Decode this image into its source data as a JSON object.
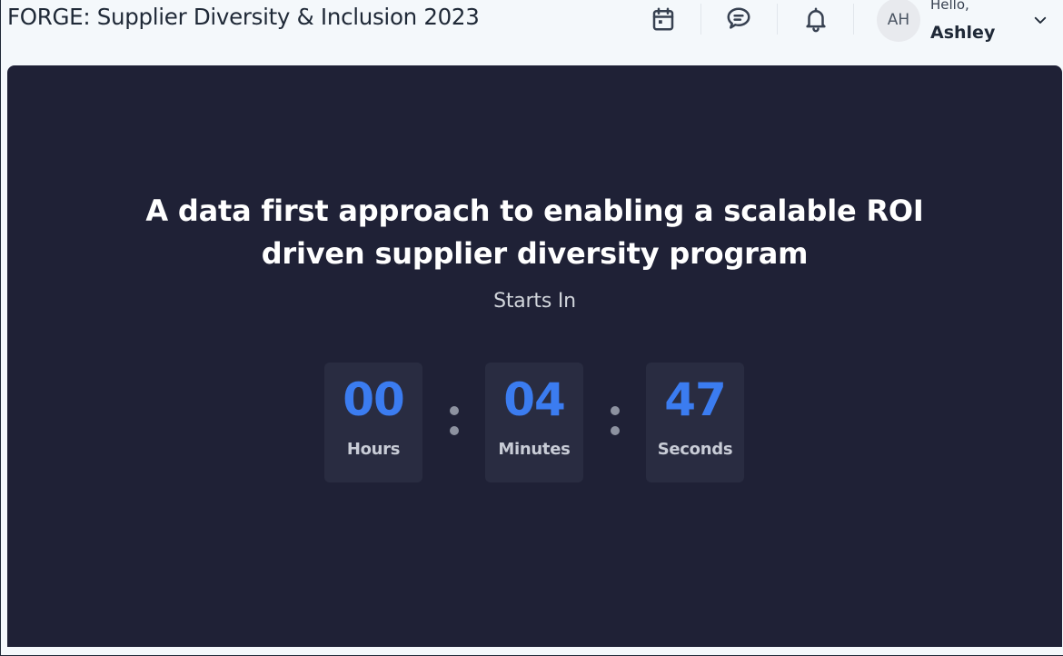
{
  "header": {
    "event_title": "FORGE: Supplier Diversity & Inclusion 2023",
    "icons": [
      "calendar-icon",
      "chat-icon",
      "bell-icon",
      "chevron-down-icon"
    ],
    "user": {
      "initials": "AH",
      "greeting": "Hello,",
      "name": "Ashley"
    }
  },
  "session": {
    "headline": "A data first approach to enabling a scalable ROI driven supplier diversity program",
    "starts_in_label": "Starts In",
    "countdown": {
      "hours": "00",
      "hours_label": "Hours",
      "minutes": "04",
      "minutes_label": "Minutes",
      "seconds": "47",
      "seconds_label": "Seconds"
    }
  },
  "colors": {
    "stage_background": "#1f2136",
    "tile_background": "#292c41",
    "countdown_digits": "#3b7cf0",
    "page_background": "#f4f8fb"
  }
}
